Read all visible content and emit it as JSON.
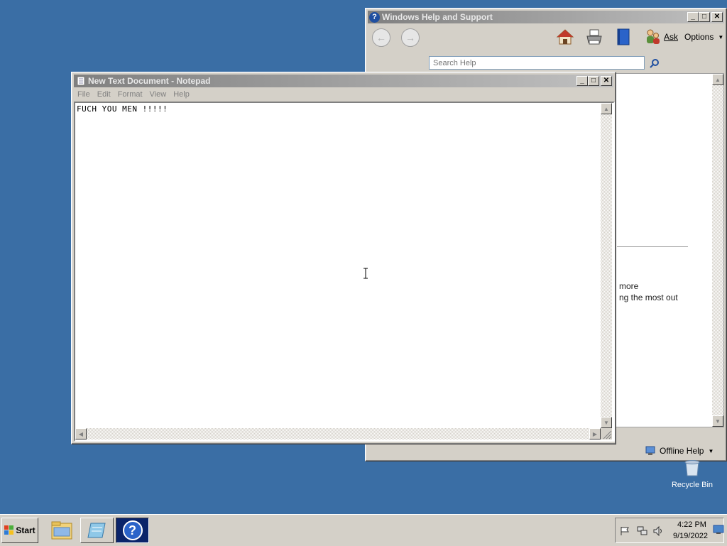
{
  "desktop": {
    "recycle_bin_label": "Recycle Bin"
  },
  "help_window": {
    "title": "Windows Help and Support",
    "toolbar": {
      "back_icon": "back-arrow-icon",
      "forward_icon": "forward-arrow-icon",
      "ask_label": "Ask",
      "options_label": "Options"
    },
    "search": {
      "placeholder": "Search Help"
    },
    "content_lines": [
      "more",
      "ng the most out"
    ],
    "footer": {
      "offline_help_label": "Offline Help"
    }
  },
  "notepad": {
    "title": "New Text Document - Notepad",
    "menu": [
      "File",
      "Edit",
      "Format",
      "View",
      "Help"
    ],
    "text": "FUCH YOU MEN !!!!!"
  },
  "taskbar": {
    "start_label": "Start",
    "clock_time": "4:22 PM",
    "clock_date": "9/19/2022"
  },
  "colors": {
    "desktop": "#3a6ea5",
    "chrome": "#d4d0c8",
    "help_blue": "#0a246a"
  }
}
